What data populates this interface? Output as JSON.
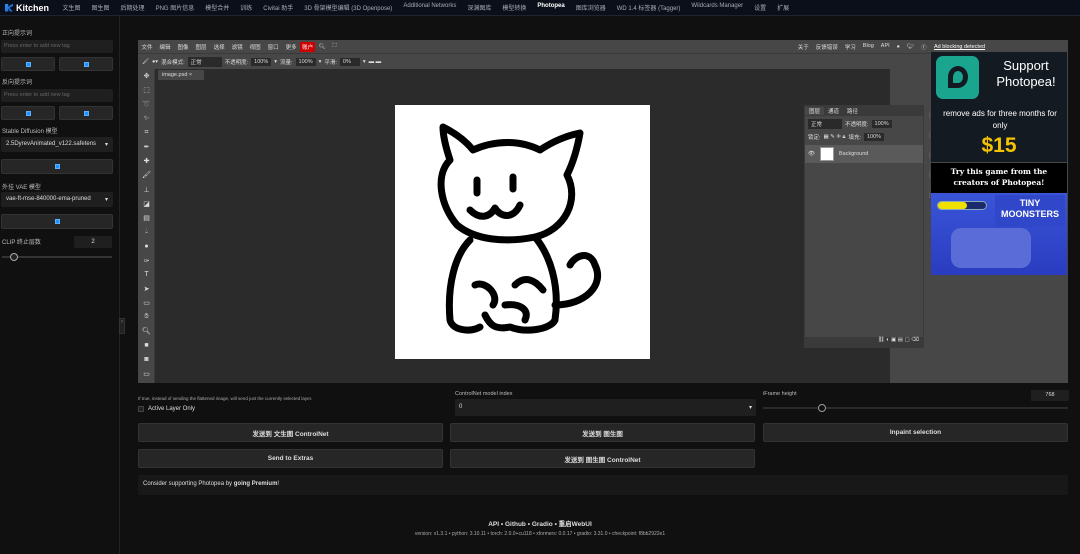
{
  "app": {
    "title": "Kitchen"
  },
  "nav": {
    "tabs": [
      "文生图",
      "图生图",
      "后期处理",
      "PNG 图片信息",
      "模型合并",
      "训练",
      "Civitai 助手",
      "3D 骨架模型编辑 (3D Openpose)",
      "Additional Networks",
      "深渊图库",
      "模型转换",
      "Photopea",
      "图库浏览器",
      "WD 1.4 标签器 (Tagger)",
      "Wildcards Manager",
      "设置",
      "扩展"
    ],
    "active": "Photopea"
  },
  "sidebar": {
    "positive_label": "正向提示词",
    "positive_placeholder": "Press enter to add new tag",
    "negative_label": "反向提示词",
    "negative_placeholder": "Press enter to add new tag",
    "sd_model_label": "Stable Diffusion 模型",
    "sd_model": "2.5DyrevAnimated_v122.safetens",
    "vae_label": "外挂 VAE 模型",
    "vae": "vae-ft-mse-840000-ema-pruned",
    "clip_label": "CLIP 终止层数",
    "clip_value": "2"
  },
  "photopea": {
    "menu": [
      "文件",
      "编辑",
      "图像",
      "图层",
      "选择",
      "滤镜",
      "视图",
      "窗口",
      "更多"
    ],
    "account": "账户",
    "right_links": [
      "关于",
      "反馈错误",
      "学习",
      "Blog",
      "API"
    ],
    "options": {
      "blend_label": "混合模式:",
      "blend": "正常",
      "opacity_label": "不透明度:",
      "opacity": "100%",
      "flow_label": "流量:",
      "flow": "100%",
      "smooth_label": "平滑:",
      "smooth": "0%"
    },
    "doc_tab": "image.psd",
    "layers_panel": {
      "tabs": [
        "图层",
        "通道",
        "路径"
      ],
      "mode": "正常",
      "opacity_label": "不透明度:",
      "opacity": "100%",
      "lock_label": "锁定:",
      "fill_label": "填充:",
      "fill": "100%",
      "layer": "Background"
    },
    "ad": {
      "notice": "Ad blocking detected",
      "support": "Support Photopea!",
      "remove": "remove ads for three months for only",
      "price": "$15",
      "game": "Try this game from the creators of Photopea!",
      "game_title": "TINY MOONSTERS"
    }
  },
  "controls": {
    "hint": "If true, instead of sending the flattened image, will send just the currently selected layer.",
    "active_layer": "Active Layer Only",
    "cn_index_label": "ControlNet model index",
    "cn_index": "0",
    "iframe_label": "iFrame height",
    "iframe_value": "768",
    "iframe_fraction": 0.18,
    "buttons": [
      "发送到 文生图 ControlNet",
      "发送到 图生图",
      "Inpaint selection",
      "Send to Extras",
      "发送到 图生图 ControlNet"
    ],
    "premium_pre": "Consider supporting Photopea by ",
    "premium_link": "going Premium",
    "premium_post": "!"
  },
  "footer": {
    "links": [
      "API",
      "Github",
      "Gradio",
      "重启WebUI"
    ],
    "versions": "version: v1.3.1  •  python: 3.10.11  •  torch: 2.0.0+cu118  •  xformers: 0.0.17  •  gradio: 3.31.0  •  checkpoint: f8bb2922e1"
  }
}
